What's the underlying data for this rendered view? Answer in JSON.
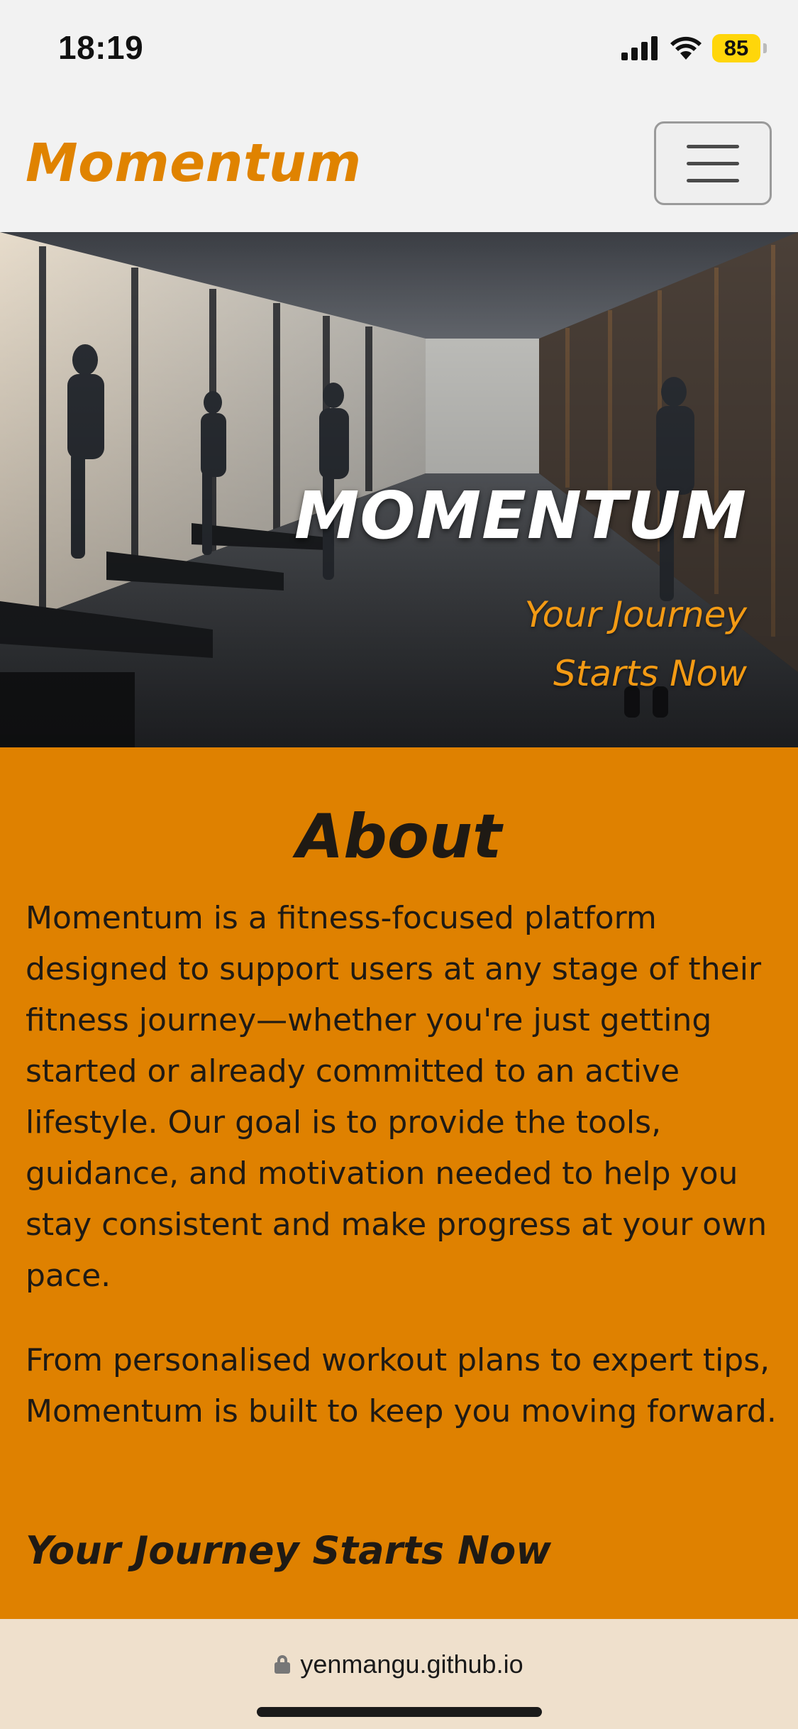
{
  "status_bar": {
    "time": "18:19",
    "battery": "85",
    "signal_icon": "cellular-signal-icon",
    "wifi_icon": "wifi-icon"
  },
  "navbar": {
    "brand": "Momentum",
    "toggle_icon": "hamburger-menu-icon"
  },
  "hero": {
    "title": "MOMENTUM",
    "subtitle": "Your Journey Starts Now"
  },
  "about": {
    "heading": "About",
    "paragraph1": "Momentum is a fitness-focused platform designed to support users at any stage of their fitness journey—whether you're just getting started or already committed to an active lifestyle. Our goal is to provide the tools, guidance, and motivation needed to help you stay consistent and make progress at your own pace.",
    "paragraph2": "From personalised workout plans to expert tips, Momentum is built to keep you moving forward.",
    "tagline": "Your Journey Starts Now"
  },
  "browser": {
    "url": "yenmangu.github.io",
    "lock_icon": "lock-icon"
  },
  "colors": {
    "accent": "#e08300",
    "about_bg": "#df8100",
    "hero_subtitle": "#f39a14",
    "text_dark": "#1f1a14"
  }
}
